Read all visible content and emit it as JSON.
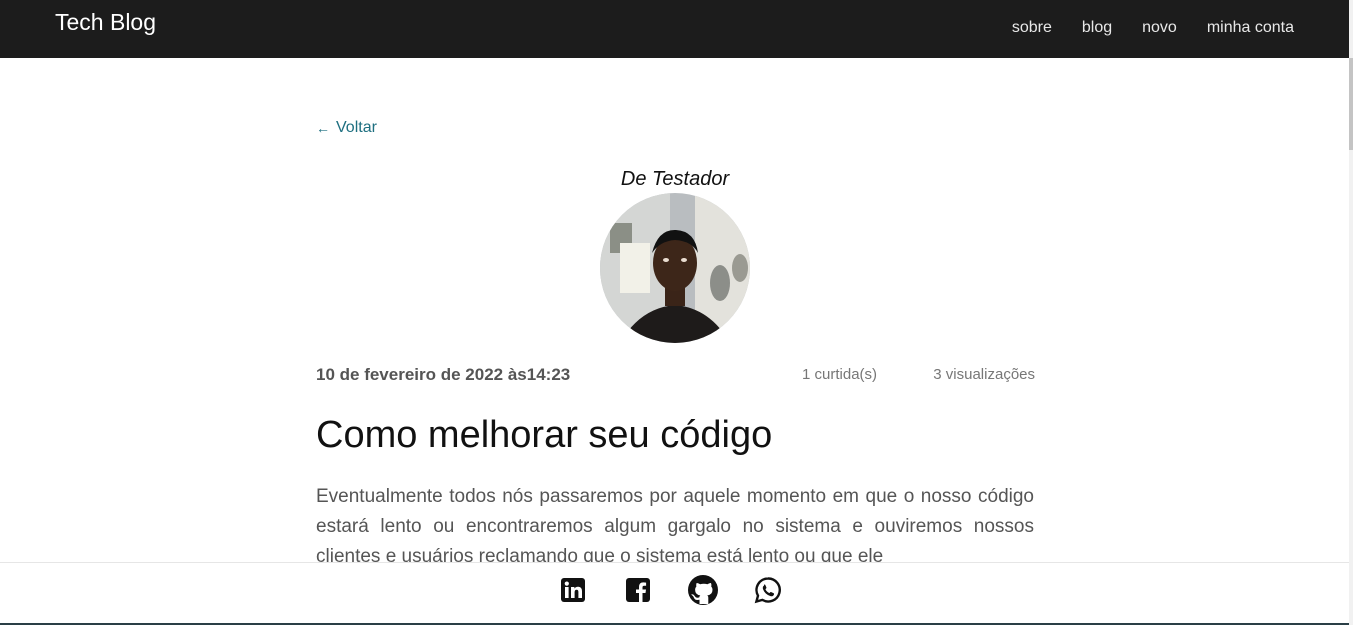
{
  "navbar": {
    "brand": "Tech Blog",
    "links": [
      "sobre",
      "blog",
      "novo",
      "minha conta"
    ]
  },
  "back": {
    "label": "Voltar",
    "icon": "arrow-left-icon"
  },
  "author": {
    "name": "De Testador"
  },
  "meta": {
    "date": "10 de fevereiro de 2022 às14:23",
    "likes": "1 curtida(s)",
    "views": "3 visualizações"
  },
  "post": {
    "title": "Como melhorar seu código",
    "excerpt": "Eventualmente todos nós passaremos por aquele momento em que o nosso código estará lento ou encontraremos algum gargalo no sistema e ouviremos nossos clientes e usuários reclamando que o sistema está lento ou que ele"
  },
  "footer": {
    "icons": [
      "linkedin-icon",
      "facebook-icon",
      "github-icon",
      "whatsapp-icon"
    ]
  },
  "colors": {
    "navbar_bg": "#1c1c1c",
    "link": "#1e6f80",
    "text_muted": "#555555"
  }
}
